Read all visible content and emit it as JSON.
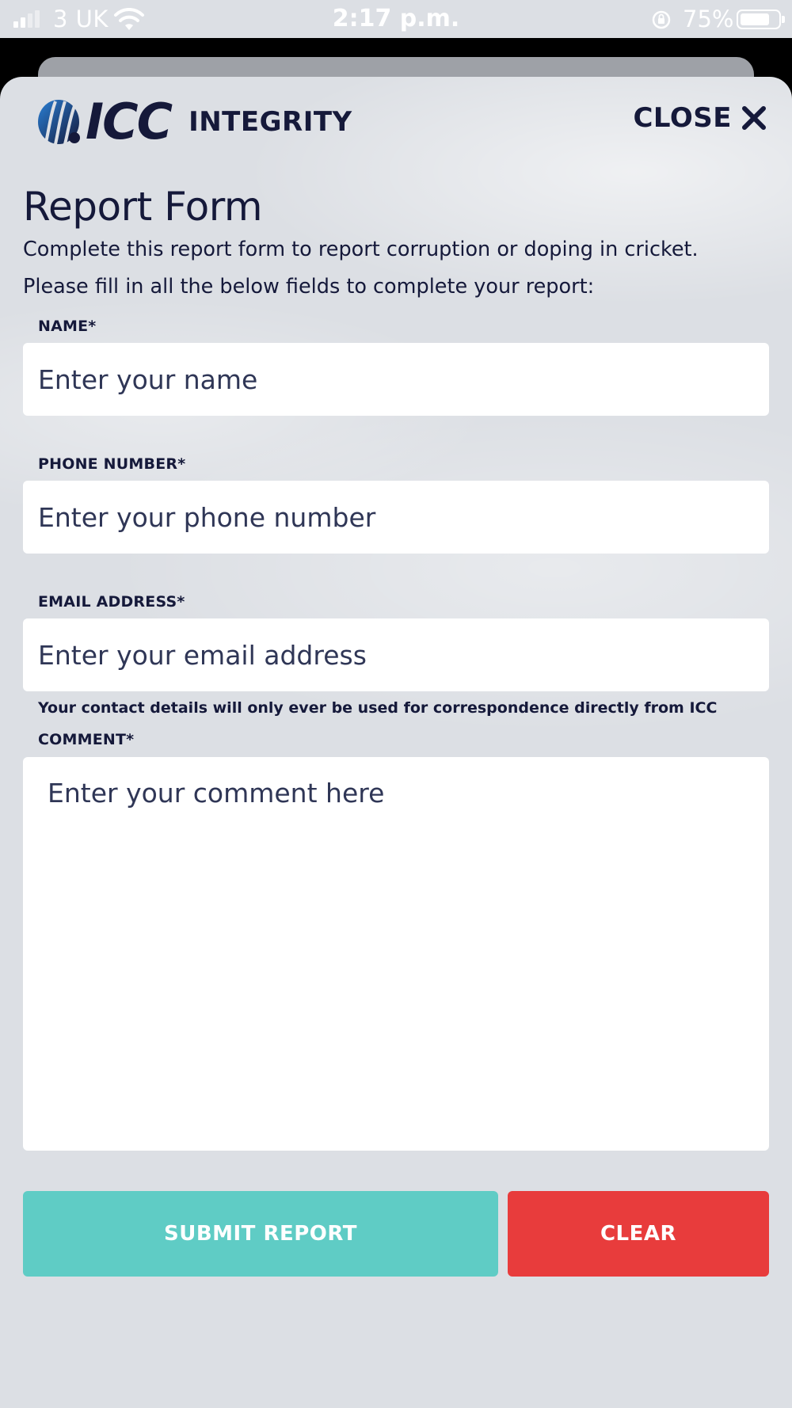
{
  "status_bar": {
    "carrier": "3 UK",
    "time": "2:17 p.m.",
    "battery_percent": "75%",
    "battery_level": 0.75,
    "icons": [
      "signal-icon",
      "wifi-icon",
      "orientation-lock-icon",
      "battery-icon"
    ]
  },
  "header": {
    "logo_text": "ICC",
    "logo_subtext": "INTEGRITY",
    "close_label": "CLOSE",
    "close_icon": "close-icon"
  },
  "form": {
    "title": "Report Form",
    "intro_line1": "Complete this report form to report corruption or doping in cricket.",
    "intro_line2": "Please fill in all the below fields to complete your report:",
    "name": {
      "label": "NAME*",
      "placeholder": "Enter your name",
      "value": ""
    },
    "phone": {
      "label": "PHONE NUMBER*",
      "placeholder": "Enter your phone number",
      "value": ""
    },
    "email": {
      "label": "EMAIL ADDRESS*",
      "placeholder": "Enter your email address",
      "value": ""
    },
    "contact_note": "Your contact details will only ever be used for correspondence directly from ICC",
    "comment": {
      "label": "COMMENT*",
      "placeholder": "Enter your comment here",
      "value": ""
    },
    "submit_label": "SUBMIT REPORT",
    "clear_label": "CLEAR"
  },
  "colors": {
    "navy_text": "#15193a",
    "sheet_background": "#dcdfe4",
    "submit_button": "#5fccc5",
    "clear_button": "#e83c3c"
  }
}
